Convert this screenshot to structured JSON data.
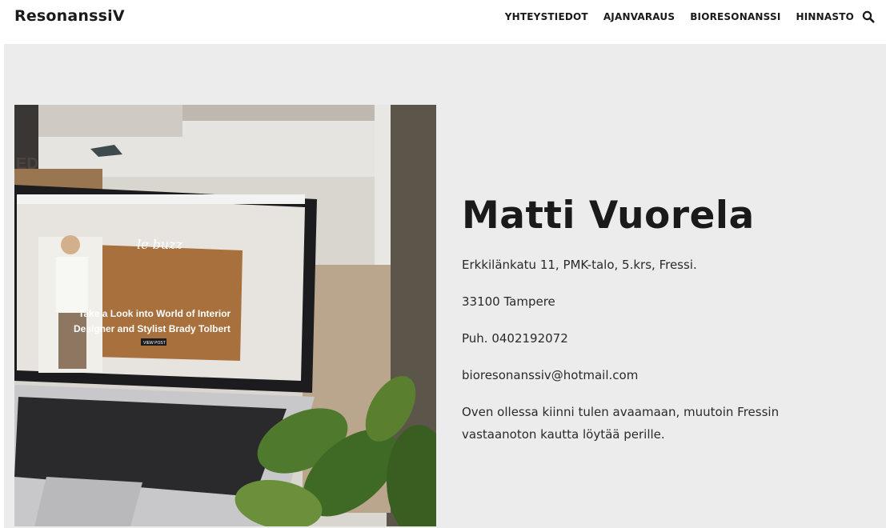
{
  "site": {
    "logo": "ResonanssiV"
  },
  "nav": {
    "items": [
      "YHTEYSTIEDOT",
      "AJANVARAUS",
      "BIORESONANSSI",
      "HINNASTO"
    ],
    "search_icon": "search-icon"
  },
  "hero": {
    "image": {
      "description_icon": "laptop-photo",
      "screen_logo": "le buzz",
      "screen_headline_1": "Take a Look into World of Interior",
      "screen_headline_2": "Designer and Stylist Brady Tolbert",
      "screen_button": "VIEW POST",
      "sign_letters": "ED"
    },
    "name": "Matti Vuorela",
    "address": "Erkkilänkatu 11, PMK-talo, 5.krs, Fressi.",
    "city": "33100 Tampere",
    "phone": "Puh. 0402192072",
    "email": "bioresonanssiv@hotmail.com",
    "note": "Oven ollessa kiinni tulen avaamaan, muutoin Fressin vastaanoton kautta löytää perille."
  },
  "colors": {
    "background": "#ffffff",
    "hero_bg": "#ececec",
    "text": "#1a1a1a"
  }
}
